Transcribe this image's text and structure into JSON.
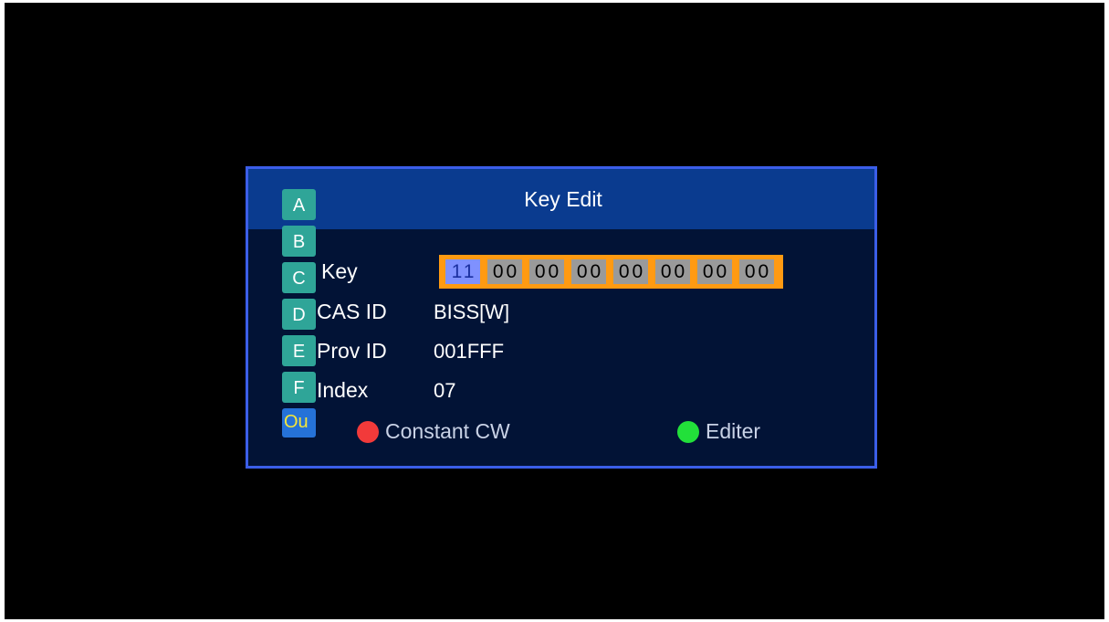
{
  "dialog": {
    "title": "Key Edit"
  },
  "hex_pad": {
    "keys": [
      "A",
      "B",
      "C",
      "D",
      "E",
      "F",
      "Ou"
    ],
    "selected_index": 6
  },
  "fields": {
    "key_label": "Key",
    "key_bytes": [
      "11",
      "00",
      "00",
      "00",
      "00",
      "00",
      "00",
      "00"
    ],
    "cas_id_label": "CAS ID",
    "cas_id_value": "BISS[W]",
    "prov_id_label": "Prov ID",
    "prov_id_value": "001FFF",
    "index_label": "Index",
    "index_value": "07"
  },
  "hints": {
    "red_label": "Constant CW",
    "green_label": "Editer"
  },
  "colors": {
    "red_button": "#f23a3a",
    "green_button": "#22e03a",
    "key_highlight": "#ff9a12",
    "header": "#0a3b8f",
    "border": "#3b5ee8"
  }
}
